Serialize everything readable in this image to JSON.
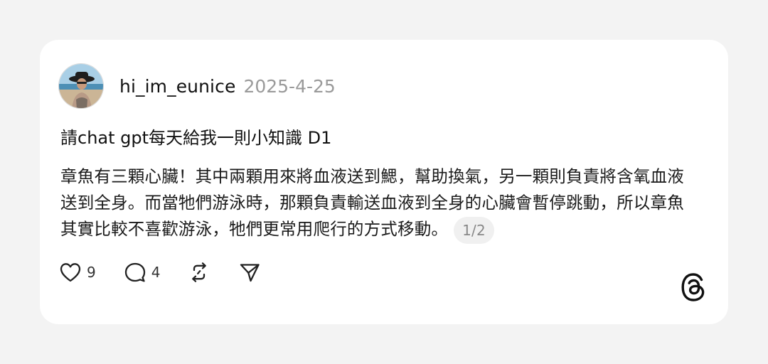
{
  "post": {
    "username": "hi_im_eunice",
    "date": "2025-4-25",
    "title": "請chat gpt每天給我一則小知識 D1",
    "body": "章魚有三顆心臟！其中兩顆用來將血液送到鰓，幫助換氣，另一顆則負責將含氧血液送到全身。而當牠們游泳時，那顆負責輸送血液到全身的心臟會暫停跳動，所以章魚其實比較不喜歡游泳，牠們更常用爬行的方式移動。",
    "page_indicator": "1/2"
  },
  "actions": {
    "like_count": "9",
    "comment_count": "4"
  },
  "icons": {
    "like": "heart-icon",
    "comment": "comment-bubble-icon",
    "repost": "repost-icon",
    "share": "send-icon",
    "brand": "threads-logo-icon"
  },
  "colors": {
    "background": "#f3f3f3",
    "card": "#ffffff",
    "date": "#9a9a9a",
    "text": "#111111"
  }
}
